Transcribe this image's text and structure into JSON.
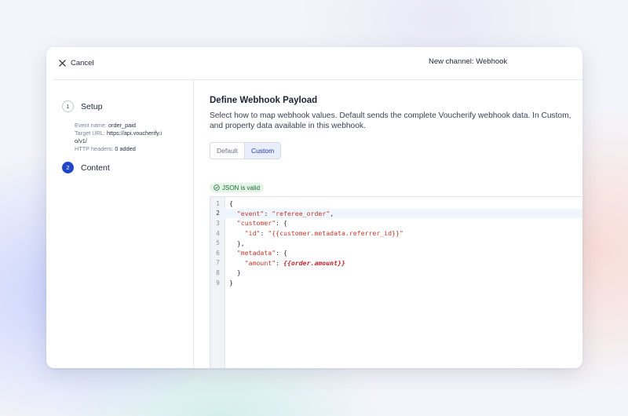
{
  "header": {
    "cancel_label": "Cancel",
    "title": "New channel: Webhook"
  },
  "steps": [
    {
      "number": "1",
      "label": "Setup",
      "state": "done"
    },
    {
      "number": "2",
      "label": "Content",
      "state": "active"
    }
  ],
  "setup_details": {
    "event_name_label": "Event name:",
    "event_name_value": "order_paid",
    "target_url_label": "Target URL:",
    "target_url_value_line1": "https://api.voucherify.i",
    "target_url_value_line2": "o/v1/",
    "headers_label": "HTTP headers:",
    "headers_value": "0 added"
  },
  "content": {
    "heading": "Define Webhook Payload",
    "description_line1": "Select how to map webhook values. Default sends the complete Voucherify webhook data. In Custom,",
    "description_line2": "and property data available in this webhook.",
    "mode_options": [
      "Default",
      "Custom"
    ],
    "selected_mode": "Custom",
    "validation_status": "JSON is valid"
  },
  "editor": {
    "highlighted_line": 2,
    "lines": [
      {
        "n": "1",
        "indent": "",
        "key": "",
        "sep": "{",
        "value": "",
        "tail": ""
      },
      {
        "n": "2",
        "indent": "  ",
        "key": "\"event\"",
        "sep": ": ",
        "value": "\"referee_order\"",
        "tail": ","
      },
      {
        "n": "3",
        "indent": "  ",
        "key": "\"customer\"",
        "sep": ": {",
        "value": "",
        "tail": ""
      },
      {
        "n": "4",
        "indent": "    ",
        "key": "\"id\"",
        "sep": ": ",
        "value": "\"{{customer.metadata.referrer_id}}\"",
        "tail": ""
      },
      {
        "n": "5",
        "indent": "  ",
        "key": "",
        "sep": "},",
        "value": "",
        "tail": ""
      },
      {
        "n": "6",
        "indent": "  ",
        "key": "\"metadata\"",
        "sep": ": {",
        "value": "",
        "tail": ""
      },
      {
        "n": "7",
        "indent": "    ",
        "key": "\"amount\"",
        "sep": ": ",
        "value": "{{order.amount}}",
        "tail": ""
      },
      {
        "n": "8",
        "indent": "  ",
        "key": "",
        "sep": "}",
        "value": "",
        "tail": ""
      },
      {
        "n": "9",
        "indent": "",
        "key": "",
        "sep": "}",
        "value": "",
        "tail": ""
      }
    ]
  }
}
